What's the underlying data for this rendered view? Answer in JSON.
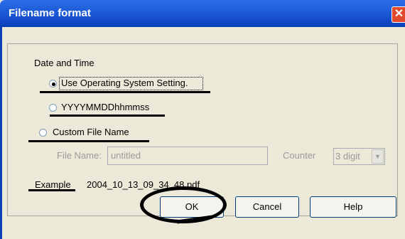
{
  "window": {
    "title": "Filename format",
    "close_glyph": "✕"
  },
  "group": {
    "label": "Date and Time"
  },
  "options": {
    "os_setting": {
      "label": "Use Operating System Setting.",
      "selected": true
    },
    "yyyymmdd": {
      "label": "YYYYMMDDhhmmss",
      "selected": false
    },
    "custom": {
      "label": "Custom File Name",
      "selected": false
    }
  },
  "custom": {
    "file_name_label": "File Name:",
    "file_name_value": "untitled",
    "counter_label": "Counter",
    "counter_value": "3 digit",
    "dropdown_glyph": "▼"
  },
  "example": {
    "label": "Example",
    "value": "2004_10_13_09_34_48.pdf"
  },
  "buttons": {
    "ok": "OK",
    "cancel": "Cancel",
    "help": "Help"
  },
  "icons": {
    "close": "close-icon",
    "dropdown": "chevron-down-icon"
  }
}
